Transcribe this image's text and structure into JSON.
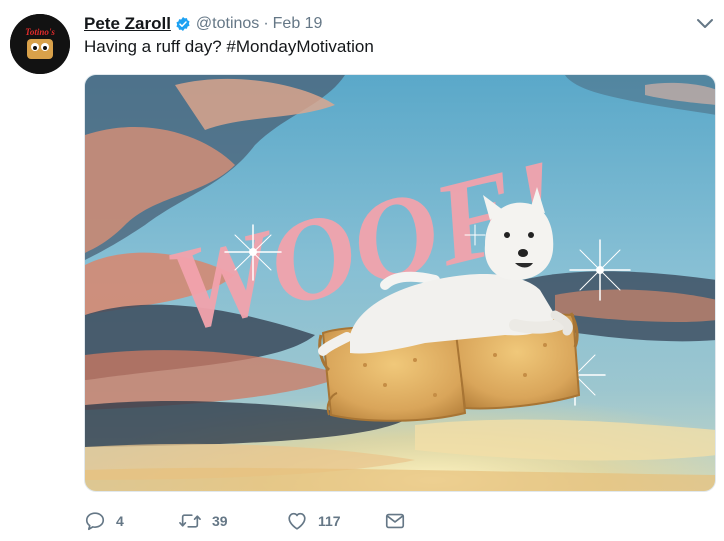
{
  "tweet": {
    "display_name": "Pete Zaroll",
    "handle": "@totinos",
    "separator": "·",
    "date": "Feb 19",
    "text": "Having a ruff day?  #MondayMotivation",
    "avatar_label": "Totino's",
    "media_text": "WOOF!",
    "verified": true
  },
  "actions": {
    "reply_count": "4",
    "retweet_count": "39",
    "like_count": "117"
  },
  "icons": {
    "verified": "verified-badge-icon",
    "caret": "chevron-down-icon",
    "reply": "reply-icon",
    "retweet": "retweet-icon",
    "like": "heart-icon",
    "dm": "envelope-icon"
  },
  "colors": {
    "verified": "#1da1f2",
    "secondary_text": "#657786",
    "woof_pink": "#f2a3ad"
  }
}
